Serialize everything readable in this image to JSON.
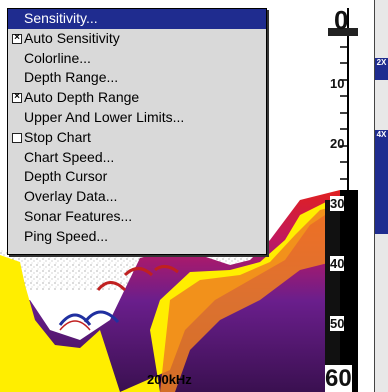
{
  "menu": {
    "items": [
      {
        "label": "Sensitivity...",
        "selected": true
      },
      {
        "label": "Auto Sensitivity",
        "checkbox": true,
        "checked": true
      },
      {
        "label": "Colorline..."
      },
      {
        "label": "Depth Range..."
      },
      {
        "label": "Auto Depth Range",
        "checkbox": true,
        "checked": true
      },
      {
        "label": "Upper And Lower Limits..."
      },
      {
        "label": "Stop Chart",
        "checkbox": true,
        "checked": false
      },
      {
        "label": "Chart Speed..."
      },
      {
        "label": "Depth Cursor"
      },
      {
        "label": "Overlay Data..."
      },
      {
        "label": "Sonar Features..."
      },
      {
        "label": "Ping Speed..."
      }
    ]
  },
  "depth_scale": [
    "0",
    "10",
    "20",
    "30",
    "40",
    "50",
    "60"
  ],
  "frequency": "200kHz",
  "zoom_tabs": [
    "2X",
    "4X"
  ],
  "colors": {
    "menu_highlight": "#1f2c8f",
    "menu_bg": "#d9d9d9",
    "sonar_bottom": "#ffee00",
    "sonar_deep": "#5b1e88"
  }
}
